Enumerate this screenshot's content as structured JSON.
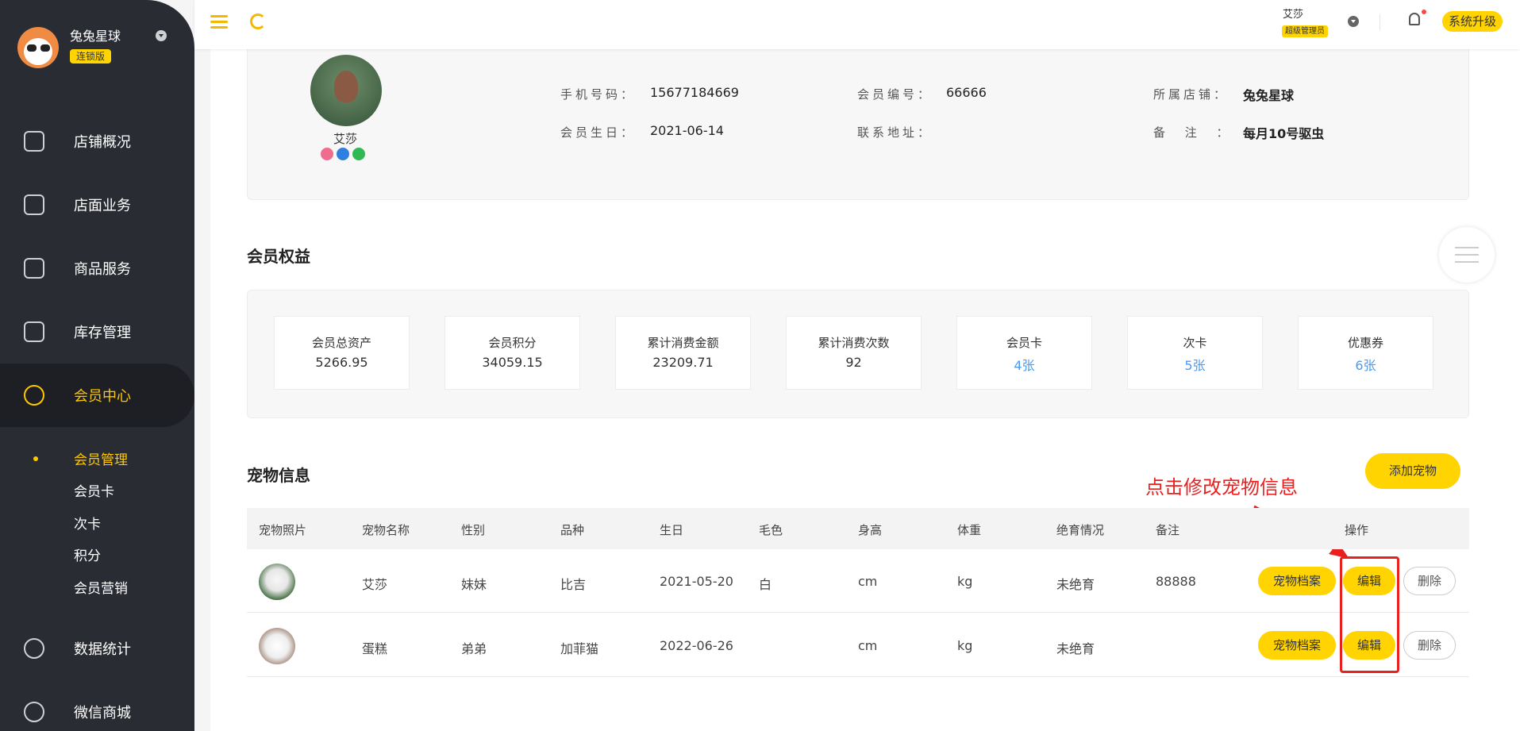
{
  "sidebar": {
    "brand_name": "兔兔星球",
    "brand_badge": "连锁版",
    "nav": [
      {
        "label": "店铺概况",
        "icon": "monitor-icon"
      },
      {
        "label": "店面业务",
        "icon": "home-icon"
      },
      {
        "label": "商品服务",
        "icon": "bag-icon"
      },
      {
        "label": "库存管理",
        "icon": "inventory-icon"
      },
      {
        "label": "会员中心",
        "icon": "member-icon"
      },
      {
        "label": "数据统计",
        "icon": "chart-icon"
      },
      {
        "label": "微信商城",
        "icon": "wechat-icon"
      }
    ],
    "sub": [
      "会员管理",
      "会员卡",
      "次卡",
      "积分",
      "会员营销"
    ]
  },
  "topbar": {
    "user_name": "艾莎",
    "user_role": "超级管理员",
    "upgrade_label": "系统升级"
  },
  "profile": {
    "name": "艾莎",
    "phone_label": "手机号码：",
    "phone": "15677184669",
    "member_no_label": "会员编号：",
    "member_no": "66666",
    "store_label": "所属店铺：",
    "store": "兔兔星球",
    "birthday_label": "会员生日：",
    "birthday": "2021-06-14",
    "address_label": "联系地址：",
    "address": "",
    "note_label": "备 注 ：",
    "note": "每月10号驱虫"
  },
  "benefits": {
    "title": "会员权益",
    "cards": [
      {
        "label": "会员总资产",
        "value": "5266.95"
      },
      {
        "label": "会员积分",
        "value": "34059.15"
      },
      {
        "label": "累计消费金额",
        "value": "23209.71"
      },
      {
        "label": "累计消费次数",
        "value": "92"
      },
      {
        "label": "会员卡",
        "value": "4张"
      },
      {
        "label": "次卡",
        "value": "5张"
      },
      {
        "label": "优惠券",
        "value": "6张"
      }
    ]
  },
  "pets": {
    "title": "宠物信息",
    "add_label": "添加宠物",
    "annotation": "点击修改宠物信息",
    "columns": [
      "宠物照片",
      "宠物名称",
      "性别",
      "品种",
      "生日",
      "毛色",
      "身高",
      "体重",
      "绝育情况",
      "备注",
      "操作"
    ],
    "rows": [
      {
        "name": "艾莎",
        "gender": "妹妹",
        "breed": "比吉",
        "birthday": "2021-05-20",
        "color": "白",
        "height": "cm",
        "weight": "kg",
        "neutered": "未绝育",
        "note": "88888"
      },
      {
        "name": "蛋糕",
        "gender": "弟弟",
        "breed": "加菲猫",
        "birthday": "2022-06-26",
        "color": "",
        "height": "cm",
        "weight": "kg",
        "neutered": "未绝育",
        "note": ""
      }
    ],
    "btn_file": "宠物档案",
    "btn_edit": "编辑",
    "btn_delete": "删除"
  },
  "colors": {
    "accent": "#ffd400",
    "sidebar": "#2a2c33",
    "annotation": "#e82020",
    "link": "#4a9bf2"
  }
}
